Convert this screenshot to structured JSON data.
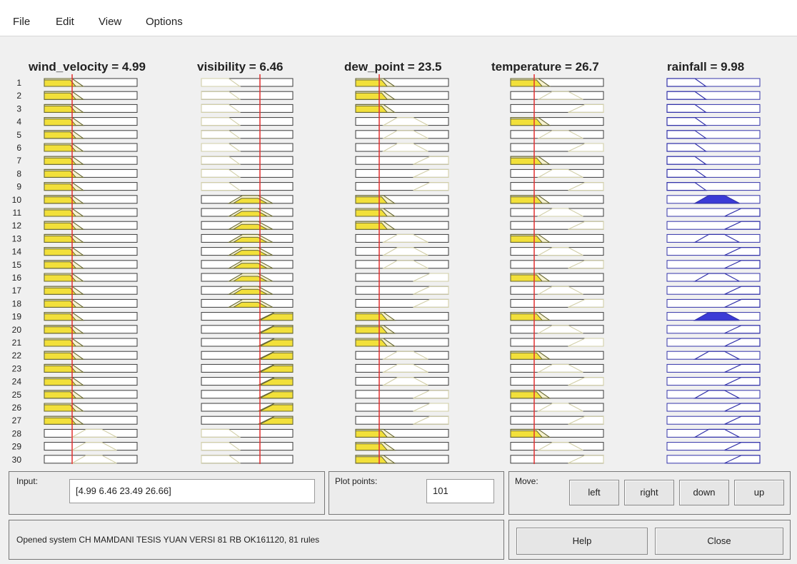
{
  "menu": [
    "File",
    "Edit",
    "View",
    "Options"
  ],
  "variables": [
    {
      "label": "wind_velocity = 4.99",
      "input": 4.99,
      "type": "input"
    },
    {
      "label": "visibility = 6.46",
      "input": 6.46,
      "type": "input"
    },
    {
      "label": "dew_point = 23.5",
      "input": 23.5,
      "type": "input"
    },
    {
      "label": "temperature = 26.7",
      "input": 26.7,
      "type": "input"
    },
    {
      "label": "rainfall = 9.98",
      "input": 9.98,
      "type": "output"
    }
  ],
  "rule_numbers": [
    "1",
    "2",
    "3",
    "4",
    "5",
    "6",
    "7",
    "8",
    "9",
    "10",
    "11",
    "12",
    "13",
    "14",
    "15",
    "16",
    "17",
    "18",
    "19",
    "20",
    "21",
    "22",
    "23",
    "24",
    "25",
    "26",
    "27",
    "28",
    "29",
    "30"
  ],
  "input_panel": {
    "label": "Input:",
    "value": "[4.99 6.46 23.49 26.66]"
  },
  "plot_points": {
    "label": "Plot points:",
    "value": "101"
  },
  "move": {
    "label": "Move:",
    "left": "left",
    "right": "right",
    "down": "down",
    "up": "up"
  },
  "status": "Opened system CH MAMDANI TESIS YUAN VERSI 81 RB OK161120, 81 rules",
  "help_label": "Help",
  "close_label": "Close",
  "colors": {
    "fill": "#f2e03a",
    "fill_light": "#f7f3cf",
    "line_active": "#666633",
    "line_inactive": "#d2cfa8",
    "output_line": "#3333aa",
    "output_fill": "#3b3bd6",
    "marker": "#e23030"
  }
}
